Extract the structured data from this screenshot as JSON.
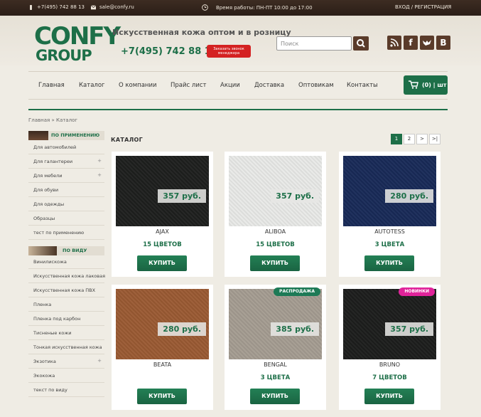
{
  "topbar": {
    "phone": "+7(495) 742 88 13",
    "email": "sale@confy.ru",
    "hours": "Время работы: ПН-ПТ 10:00 до 17:00",
    "login": "ВХОД / РЕГИСТРАЦИЯ"
  },
  "header": {
    "logo_line1": "CONFY",
    "logo_line2": "GROUP",
    "tagline": "Искусственная кожа оптом и в розницу",
    "phone": "+7(495) 742 88 13",
    "callback_label": "Заказать звонок менеджера",
    "search_placeholder": "Поиск",
    "social": [
      "rss-icon",
      "f",
      "y",
      "B"
    ]
  },
  "nav": {
    "items": [
      "Главная",
      "Каталог",
      "О компании",
      "Прайс лист",
      "Акции",
      "Доставка",
      "Оптовикам",
      "Контакты"
    ],
    "cart_label": "(0) | шт"
  },
  "breadcrumb": "Главная » Каталог",
  "sidebar": {
    "group1_title": "ПО ПРИМЕНЕНИЮ",
    "group1": [
      {
        "label": "Для автомобилей",
        "plus": false
      },
      {
        "label": "Для галантереи",
        "plus": true
      },
      {
        "label": "Для мебели",
        "plus": true
      },
      {
        "label": "Для обуви",
        "plus": false
      },
      {
        "label": "Для одежды",
        "plus": false
      },
      {
        "label": "Образцы",
        "plus": false
      },
      {
        "label": "тест по применению",
        "plus": false
      }
    ],
    "group2_title": "ПО ВИДУ",
    "group2": [
      {
        "label": "Винилискожа",
        "plus": false
      },
      {
        "label": "Искусственная кожа лаковая",
        "plus": false
      },
      {
        "label": "Искусственная кожа ПВХ",
        "plus": false
      },
      {
        "label": "Пленка",
        "plus": false
      },
      {
        "label": "Пленка под карбон",
        "plus": false
      },
      {
        "label": "Тисненые кожи",
        "plus": false
      },
      {
        "label": "Тонкая искусственная кожа",
        "plus": false
      },
      {
        "label": "Экзотика",
        "plus": true
      },
      {
        "label": "Экокожа",
        "plus": false
      },
      {
        "label": "текст по виду",
        "plus": false
      }
    ]
  },
  "catalog": {
    "title": "КАТАЛОГ",
    "pages": [
      "1",
      "2",
      ">",
      ">|"
    ],
    "buy_label": "КУПИТЬ",
    "products": [
      {
        "name": "AJAX",
        "price": "357 руб.",
        "colors": "15 ЦВЕТОВ",
        "swatch": "#1e1f1e",
        "badge": ""
      },
      {
        "name": "ALIBOA",
        "price": "357 руб.",
        "colors": "15 ЦВЕТОВ",
        "swatch": "#e8e9e7",
        "badge": ""
      },
      {
        "name": "AUTOTESS",
        "price": "280 руб.",
        "colors": "3 ЦВЕТА",
        "swatch": "#182a57",
        "badge": ""
      },
      {
        "name": "BEATA",
        "price": "280 руб.",
        "colors": "",
        "swatch": "#9a5a33",
        "badge": ""
      },
      {
        "name": "BENGAL",
        "price": "385 руб.",
        "colors": "3 ЦВЕТА",
        "swatch": "#a49c91",
        "badge": "РАСПРОДАЖА",
        "badge_color": "#1d7a56"
      },
      {
        "name": "BRUNO",
        "price": "357 руб.",
        "colors": "7 ЦВЕТОВ",
        "swatch": "#1c1d1c",
        "badge": "НОВИНКИ",
        "badge_color": "#e0239a"
      }
    ]
  }
}
